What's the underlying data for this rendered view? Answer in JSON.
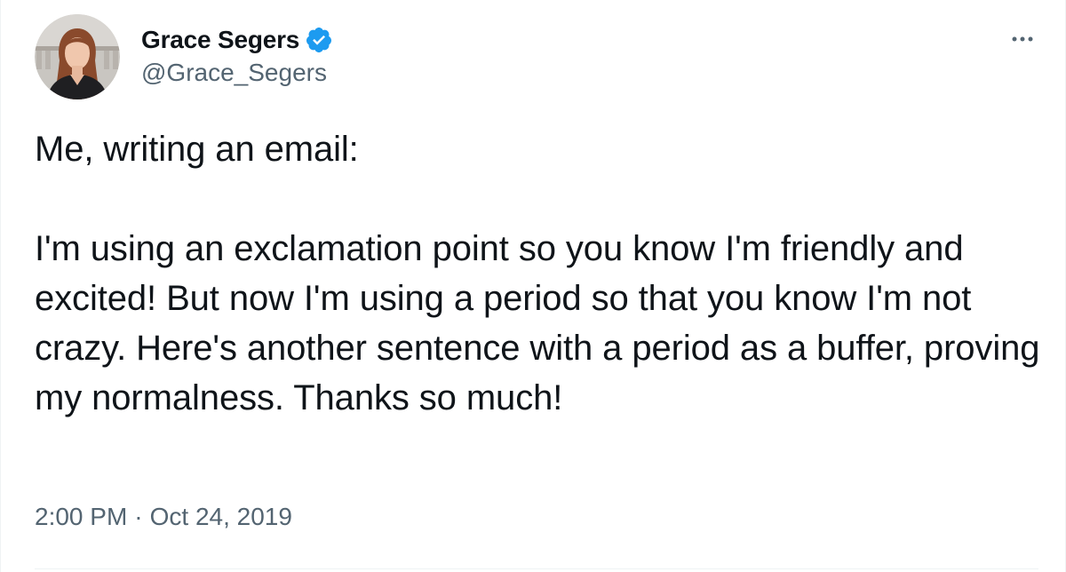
{
  "author": {
    "display_name": "Grace Segers",
    "handle": "@Grace_Segers",
    "verified_icon": "verified-badge-icon",
    "avatar_icon": "profile-photo"
  },
  "tweet": {
    "text": "Me, writing an email:\n\nI'm using an exclamation point so you know I'm friendly and excited! But now I'm using a period so that you know I'm not crazy. Here's another sentence with a period as a buffer, proving my normalness. Thanks so much!",
    "time": "2:00 PM",
    "separator": "·",
    "date": "Oct 24, 2019"
  },
  "colors": {
    "text": "#0f1419",
    "secondary": "#536471",
    "verified": "#1d9bf0",
    "divider": "#eff3f4"
  },
  "more_icon": "more-horizontal-icon"
}
